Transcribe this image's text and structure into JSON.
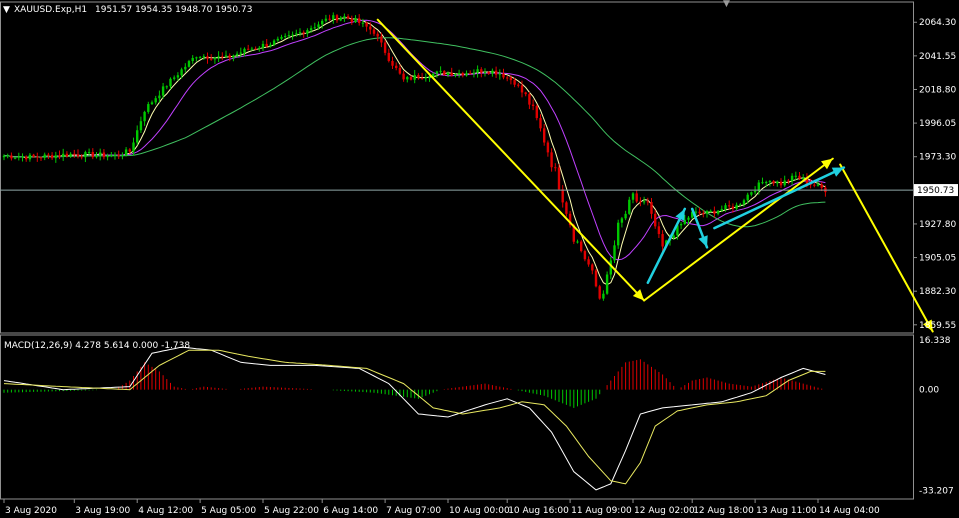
{
  "header": {
    "symbol_label": "XAUUSD.Exp,H1",
    "ohlc_label": "1951.57 1954.35 1948.70 1950.73"
  },
  "macd_header": "MACD(12,26,9) 4.278 5.614 0.000 -1.738",
  "colors": {
    "background": "#000000",
    "bull": "#00c800",
    "bear": "#e00000",
    "ma_fast": "#ffffb0",
    "ma_mid": "#c040ff",
    "ma_slow": "#40c060",
    "price_line": "#8fa8a8",
    "arrow_yellow": "#ffff00",
    "arrow_cyan": "#20d0e0",
    "frame": "#909090"
  },
  "chart_data": [
    {
      "type": "candlestick",
      "symbol": "XAUUSD.Exp",
      "timeframe": "H1",
      "y_ticks": [
        "2064.30",
        "2041.55",
        "2018.80",
        "1996.05",
        "1973.30",
        "1927.80",
        "1905.05",
        "1882.30",
        "1859.55"
      ],
      "y_tick_values": [
        2064.3,
        2041.55,
        2018.8,
        1996.05,
        1973.3,
        1927.8,
        1905.05,
        1882.3,
        1859.55
      ],
      "current_price_label": "1950.73",
      "current_price": 1950.73,
      "ylim": [
        1854,
        2078
      ],
      "x_ticks": [
        "3 Aug 2020",
        "3 Aug 19:00",
        "4 Aug 12:00",
        "5 Aug 05:00",
        "5 Aug 22:00",
        "6 Aug 14:00",
        "7 Aug 07:00",
        "10 Aug 00:00",
        "10 Aug 16:00",
        "11 Aug 09:00",
        "12 Aug 02:00",
        "12 Aug 18:00",
        "13 Aug 11:00",
        "14 Aug 04:00"
      ],
      "x_tick_index": [
        0,
        19,
        36,
        53,
        70,
        86,
        103,
        120,
        136,
        153,
        170,
        186,
        203,
        220
      ],
      "price_path": {
        "bar_index": [
          0,
          8,
          18,
          30,
          34,
          38,
          44,
          52,
          60,
          66,
          72,
          78,
          84,
          88,
          92,
          96,
          100,
          104,
          108,
          112,
          118,
          124,
          130,
          134,
          138,
          142,
          146,
          150,
          154,
          158,
          161,
          163,
          166,
          170,
          174,
          178,
          182,
          186,
          190,
          194,
          198,
          202,
          206,
          210,
          214,
          218,
          222
        ],
        "close": [
          1974,
          1973,
          1975,
          1974,
          1977,
          2005,
          2022,
          2042,
          2040,
          2046,
          2050,
          2055,
          2062,
          2067,
          2068,
          2064,
          2058,
          2040,
          2025,
          2028,
          2030,
          2030,
          2032,
          2030,
          2024,
          2010,
          1985,
          1955,
          1920,
          1900,
          1878,
          1890,
          1925,
          1945,
          1940,
          1912,
          1925,
          1935,
          1935,
          1938,
          1940,
          1950,
          1958,
          1955,
          1960,
          1955,
          1951
        ]
      }
    },
    {
      "type": "macd",
      "title": "MACD(12,26,9) 4.278 5.614 0.000 -1.738",
      "y_ticks": [
        "16.338",
        "0.00",
        "-33.207"
      ],
      "y_tick_values": [
        16.338,
        0,
        -33.207
      ],
      "ylim": [
        -36,
        18
      ],
      "macd_path": {
        "bar_index": [
          0,
          16,
          34,
          40,
          48,
          56,
          64,
          72,
          84,
          96,
          104,
          112,
          120,
          130,
          136,
          142,
          148,
          154,
          160,
          164,
          168,
          172,
          178,
          186,
          194,
          202,
          210,
          216,
          222
        ],
        "value": [
          3,
          0,
          1,
          12,
          14,
          13,
          9,
          8,
          8,
          7,
          2,
          -8,
          -9,
          -5,
          -3,
          -6,
          -14,
          -27,
          -33,
          -31,
          -20,
          -8,
          -6,
          -5,
          -4,
          -1,
          4,
          7,
          5
        ]
      },
      "signal_path": {
        "bar_index": [
          0,
          16,
          34,
          42,
          50,
          58,
          66,
          76,
          88,
          98,
          108,
          116,
          124,
          134,
          140,
          146,
          152,
          158,
          164,
          168,
          172,
          176,
          182,
          190,
          198,
          206,
          212,
          218,
          222
        ],
        "value": [
          2,
          1,
          0,
          8,
          13,
          13,
          11,
          9,
          8,
          7,
          2,
          -6,
          -8,
          -6,
          -4,
          -5,
          -12,
          -22,
          -30,
          -31,
          -24,
          -12,
          -7,
          -5,
          -4,
          -2,
          3,
          6,
          6
        ]
      },
      "histogram_path": {
        "bar_index": [
          0,
          30,
          34,
          38,
          42,
          46,
          50,
          54,
          62,
          70,
          86,
          100,
          106,
          112,
          118,
          124,
          130,
          134,
          138,
          146,
          150,
          154,
          160,
          164,
          168,
          172,
          178,
          182,
          186,
          190,
          196,
          202,
          210,
          216,
          222
        ],
        "value": [
          -1,
          0,
          3,
          9,
          6,
          1,
          0,
          1,
          0,
          1,
          0,
          -1,
          -2,
          -3,
          0,
          1,
          2,
          1,
          0,
          -2,
          -4,
          -6,
          -3,
          3,
          9,
          10,
          5,
          0,
          3,
          4,
          2,
          1,
          4,
          2,
          0
        ]
      }
    }
  ]
}
